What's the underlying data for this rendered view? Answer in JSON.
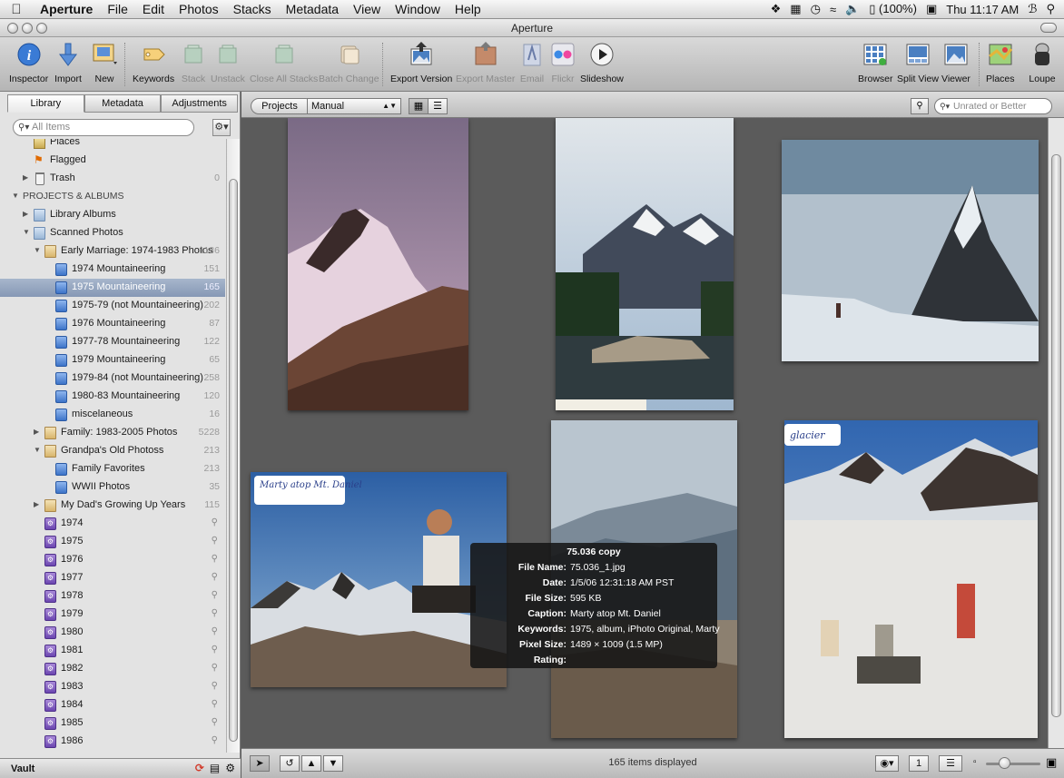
{
  "menubar": {
    "app_name": "Aperture",
    "items": [
      "File",
      "Edit",
      "Photos",
      "Stacks",
      "Metadata",
      "View",
      "Window",
      "Help"
    ],
    "battery": "(100%)",
    "clock": "Thu 11:17 AM"
  },
  "window": {
    "title": "Aperture"
  },
  "toolbar": {
    "inspector": "Inspector",
    "import": "Import",
    "new": "New",
    "keywords": "Keywords",
    "stack": "Stack",
    "unstack": "Unstack",
    "close_all_stacks": "Close All Stacks",
    "batch_change": "Batch Change",
    "export_version": "Export Version",
    "export_master": "Export Master",
    "email": "Email",
    "flickr": "Flickr",
    "slideshow": "Slideshow",
    "browser": "Browser",
    "split_view": "Split View",
    "viewer": "Viewer",
    "places": "Places",
    "loupe": "Loupe"
  },
  "sidebar": {
    "tabs": [
      "Library",
      "Metadata",
      "Adjustments"
    ],
    "search_placeholder": "All Items",
    "top_partial": "Places",
    "flagged": "Flagged",
    "trash": {
      "label": "Trash",
      "count": "0"
    },
    "section_heading": "PROJECTS & ALBUMS",
    "library_albums": "Library Albums",
    "scanned_photos": "Scanned Photos",
    "early_marriage": {
      "label": "Early Marriage: 1974-1983 Photos",
      "count": "1186"
    },
    "early_albums": [
      {
        "label": "1974 Mountaineering",
        "count": "151"
      },
      {
        "label": "1975 Mountaineering",
        "count": "165"
      },
      {
        "label": "1975-79 (not Mountaineering)",
        "count": "202"
      },
      {
        "label": "1976 Mountaineering",
        "count": "87"
      },
      {
        "label": "1977-78 Mountaineering",
        "count": "122"
      },
      {
        "label": "1979 Mountaineering",
        "count": "65"
      },
      {
        "label": "1979-84 (not Mountaineering)",
        "count": "258"
      },
      {
        "label": "1980-83 Mountaineering",
        "count": "120"
      },
      {
        "label": "miscelaneous",
        "count": "16"
      }
    ],
    "family": {
      "label": "Family: 1983-2005 Photos",
      "count": "5228"
    },
    "grandpa": {
      "label": "Grandpa's Old Photoss",
      "count": "213"
    },
    "grandpa_albums": [
      {
        "label": "Family Favorites",
        "count": "213"
      },
      {
        "label": "WWII Photos",
        "count": "35"
      }
    ],
    "dad": {
      "label": "My Dad's Growing Up Years",
      "count": "115"
    },
    "years": [
      "1974",
      "1975",
      "1976",
      "1977",
      "1978",
      "1979",
      "1980",
      "1981",
      "1982",
      "1983",
      "1984",
      "1985",
      "1986"
    ],
    "vault_label": "Vault"
  },
  "browser": {
    "projects_button": "Projects",
    "sort_value": "Manual",
    "filter_placeholder": "Unrated or Better",
    "items_displayed": "165 items displayed"
  },
  "hud": {
    "title": "75.036 copy",
    "file_name_key": "File Name:",
    "file_name": "75.036_1.jpg",
    "date_key": "Date:",
    "date": "1/5/06 12:31:18 AM PST",
    "file_size_key": "File Size:",
    "file_size": "595 KB",
    "caption_key": "Caption:",
    "caption": "Marty atop Mt. Daniel",
    "keywords_key": "Keywords:",
    "keywords": "1975, album, iPhoto Original, Marty",
    "pixel_size_key": "Pixel Size:",
    "pixel_size": "1489 × 1009 (1.5 MP)",
    "rating_key": "Rating:"
  },
  "photos": {
    "handwritten_marty": "Marty atop Mt. Daniel",
    "handwritten_glacier": "glacier"
  }
}
